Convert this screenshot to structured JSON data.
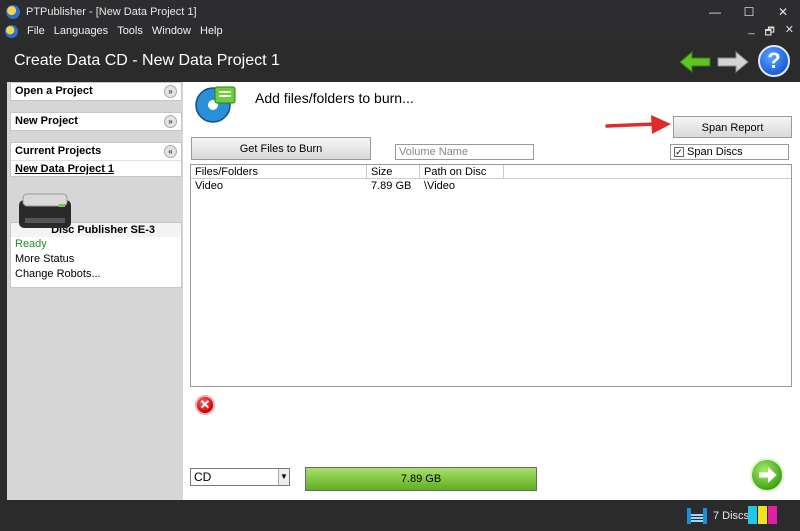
{
  "window": {
    "title": "PTPublisher - [New Data Project 1]",
    "controls": [
      "—",
      "☐",
      "✕"
    ]
  },
  "menu": {
    "items": [
      "File",
      "Languages",
      "Tools",
      "Window",
      "Help"
    ],
    "mdi_controls": [
      "_",
      "🗗",
      "✕"
    ]
  },
  "header": {
    "title": "Create Data CD  -  New Data Project 1",
    "help_label": "?"
  },
  "sidebar": {
    "open_project": "Open a Project",
    "new_project": "New Project",
    "current_projects": "Current Projects",
    "current_project_name": "New Data Project 1",
    "chev_down": "»",
    "chev_up": "«",
    "printer": {
      "name": "Disc Publisher SE-3",
      "status": "Ready",
      "more_status": "More Status",
      "change_robots": "Change Robots..."
    }
  },
  "main": {
    "heading": "Add files/folders to burn...",
    "get_files_label": "Get Files to Burn",
    "span_report_label": "Span Report",
    "volume_placeholder": "Volume Name",
    "span_discs_label": "Span Discs",
    "span_discs_checked": "✓",
    "table": {
      "columns": [
        "Files/Folders",
        "Size",
        "Path on Disc"
      ],
      "rows": [
        [
          "Video",
          "7.89 GB",
          "\\Video"
        ]
      ]
    },
    "error_label": "✕",
    "media_value": "CD",
    "media_arrow": "▼",
    "progress_label": "7.89 GB",
    "progress_fraction": 1.0
  },
  "status": {
    "disc_count": "7 Discs"
  },
  "colors": {
    "accent_green": "#5fae22",
    "help_blue": "#1b5fd6",
    "arrow_red": "#e02b2b"
  }
}
